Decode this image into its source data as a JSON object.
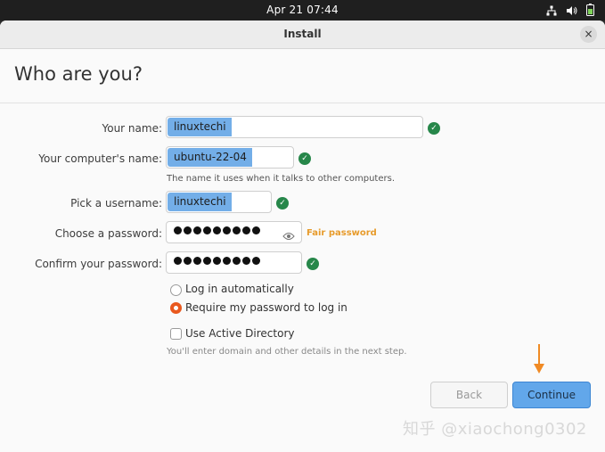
{
  "topbar": {
    "clock": "Apr 21  07:44",
    "icons": [
      "network-icon",
      "volume-icon",
      "battery-icon"
    ]
  },
  "window": {
    "title": "Install",
    "close_label": "×"
  },
  "heading": "Who are you?",
  "form": {
    "name": {
      "label": "Your name:",
      "value": "linuxtechi"
    },
    "computer": {
      "label": "Your computer's name:",
      "value": "ubuntu-22-04",
      "hint": "The name it uses when it talks to other computers."
    },
    "username": {
      "label": "Pick a username:",
      "value": "linuxtechi"
    },
    "password": {
      "label": "Choose a password:",
      "masked_length": 9,
      "strength": "Fair password"
    },
    "confirm": {
      "label": "Confirm your password:",
      "masked_length": 9
    }
  },
  "login_options": {
    "auto_label": "Log in automatically",
    "require_label": "Require my password to log in",
    "selected": "require"
  },
  "active_directory": {
    "label": "Use Active Directory",
    "checked": false,
    "note": "You'll enter domain and other details in the next step."
  },
  "buttons": {
    "back": "Back",
    "continue": "Continue"
  },
  "watermark": "知乎 @xiaochong0302",
  "colors": {
    "accent": "#e9591f",
    "selection": "#73aee8",
    "check": "#27874a",
    "strength": "#e79b2b",
    "continue": "#62a7ea",
    "arrow": "#f08a24"
  }
}
